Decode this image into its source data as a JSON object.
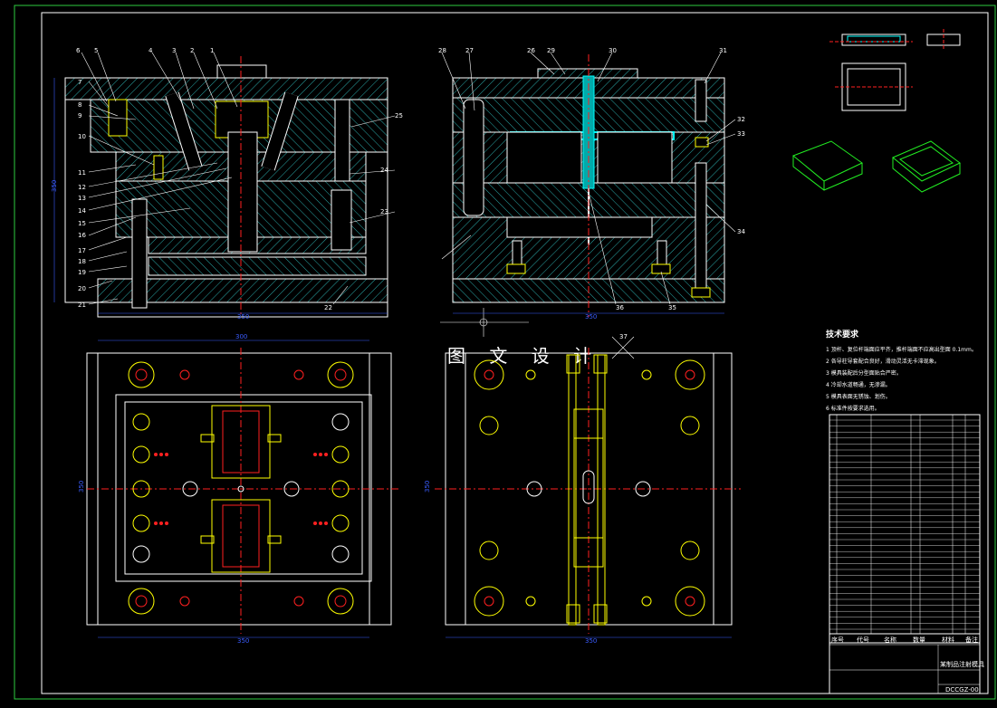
{
  "watermark": "图 文 设 计",
  "technical_requirements": {
    "title": "技术要求",
    "lines": [
      "1 顶杆、复位杆端面应平齐，推杆端面不应高出型面 0.1mm。",
      "2 各导柱导套配合良好，滑动灵活无卡滞现象。",
      "3 模具装配后分型面贴合严密。",
      "4 冷却水道畅通，无渗漏。",
      "5 模具表面无锈蚀、划伤。",
      "6 标准件按要求选用。"
    ]
  },
  "view_labels": {
    "left_section": [
      "6",
      "5",
      "4",
      "3",
      "2",
      "1",
      "7",
      "8",
      "9",
      "10",
      "11",
      "12",
      "13",
      "14",
      "15",
      "16",
      "17",
      "18",
      "19",
      "20",
      "21",
      "22",
      "23",
      "24",
      "25"
    ],
    "right_section": [
      "28",
      "27",
      "26",
      "29",
      "30",
      "31",
      "32",
      "33",
      "34",
      "35",
      "36"
    ],
    "bottom_right": [
      "37"
    ]
  },
  "dimensions": {
    "top_left_width": "350",
    "top_right_width": "350",
    "bottom_left_top": "300",
    "bottom_left_width": "350",
    "bottom_right_width": "350",
    "left_height": "350",
    "bottom_left_height": "350",
    "bottom_right_height": "350"
  },
  "title_block": {
    "drawing_title": "某制品注射模具",
    "drawing_no": "DCCGZ-00",
    "footer": [
      "序号",
      "代号",
      "名称",
      "数量",
      "材料",
      "备注"
    ]
  },
  "colors": {
    "background": "#000000",
    "outline": "#ffffff",
    "hatch": "#2aa8a8",
    "centerline": "#ff2020",
    "yellow": "#ffdd00",
    "green": "#22ee22",
    "cyan": "#00ffff",
    "dimension": "#3a5cff"
  }
}
